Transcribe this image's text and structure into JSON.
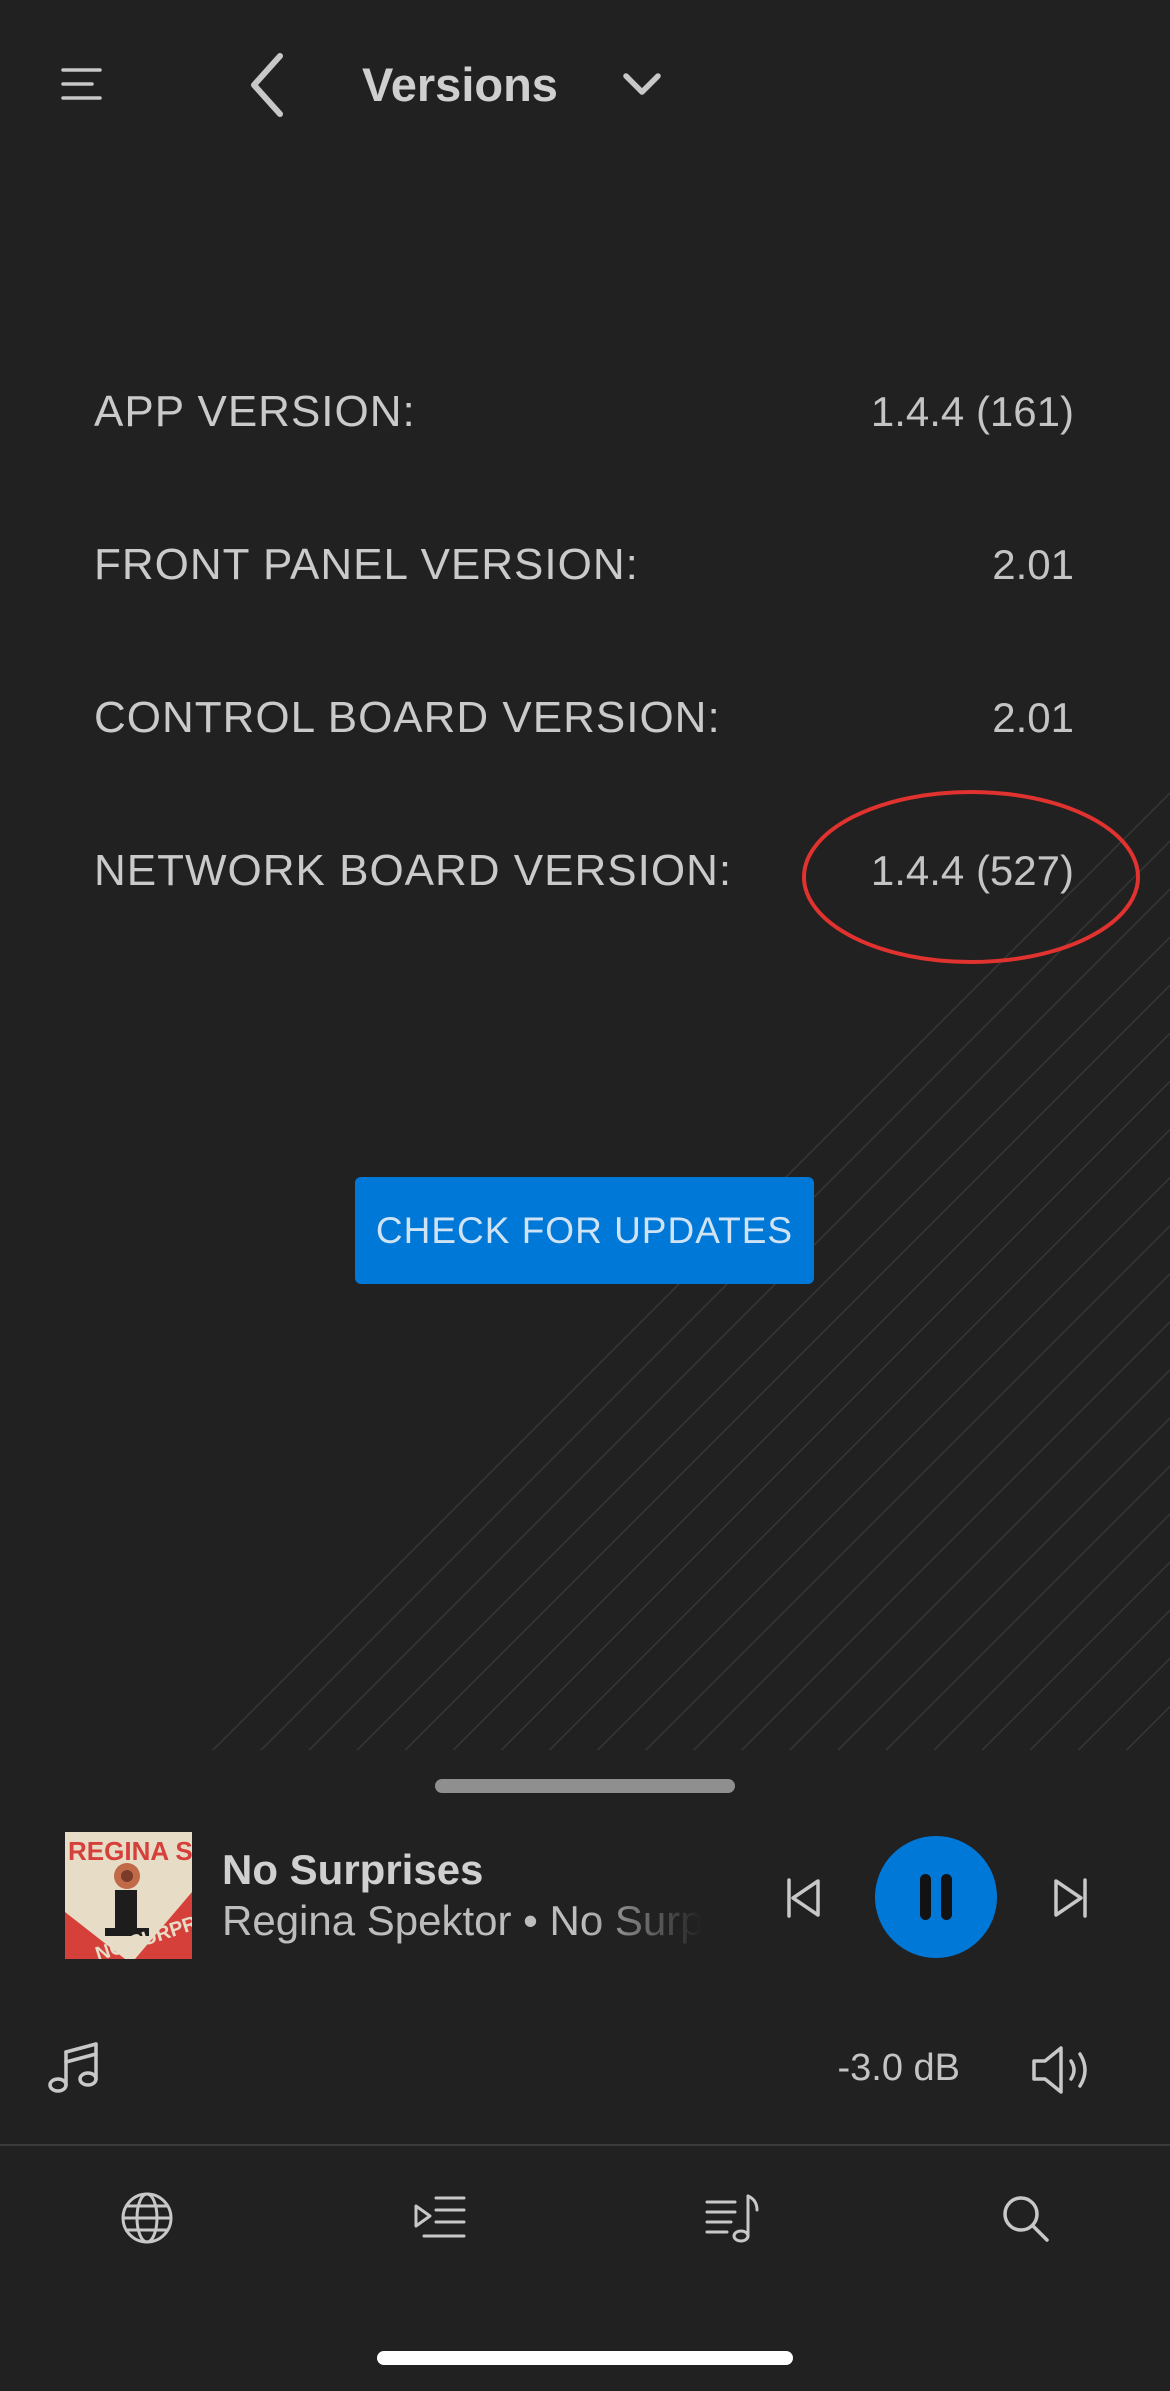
{
  "header": {
    "title": "Versions",
    "menu_icon": "hamburger-menu-icon",
    "back_icon": "chevron-left-icon",
    "dropdown_icon": "chevron-down-icon"
  },
  "versions": {
    "rows": [
      {
        "label": "APP VERSION:",
        "value": "1.4.4 (161)"
      },
      {
        "label": "FRONT PANEL VERSION:",
        "value": "2.01"
      },
      {
        "label": "CONTROL BOARD VERSION:",
        "value": "2.01"
      },
      {
        "label": "NETWORK BOARD VERSION:",
        "value": "1.4.4 (527)"
      }
    ],
    "highlight_color": "#e0322e"
  },
  "actions": {
    "check_updates_label": "CHECK FOR UPDATES",
    "accent_color": "#0078d7"
  },
  "player": {
    "track_title": "No Surprises",
    "track_subtitle": "Regina Spektor • No Surprises",
    "album_art_text_top": "REGINA SPEKTOR",
    "album_art_text_bottom": "NO SURPRISES",
    "volume": "-3.0 dB",
    "state": "playing"
  },
  "nav": {
    "items": [
      {
        "icon": "globe-icon"
      },
      {
        "icon": "queue-play-icon"
      },
      {
        "icon": "music-library-icon"
      },
      {
        "icon": "search-icon"
      }
    ]
  }
}
